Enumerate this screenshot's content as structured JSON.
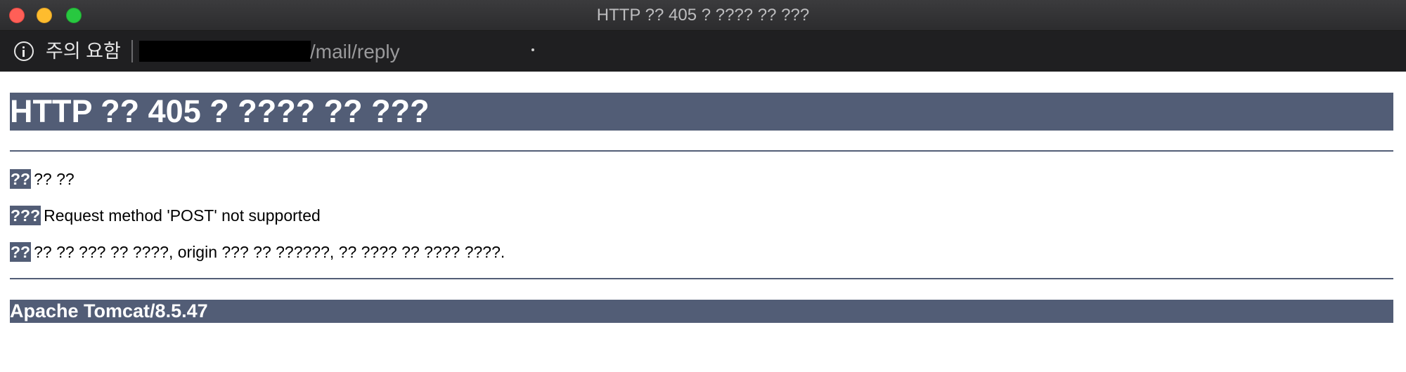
{
  "window": {
    "title": "HTTP ?? 405 ? ???? ?? ???"
  },
  "address_bar": {
    "security_label": "주의 요함",
    "url_visible": "/mail/reply",
    "icon": "info-icon"
  },
  "page": {
    "heading": "HTTP ?? 405 ? ???? ?? ???",
    "rows": [
      {
        "label": "??",
        "text": "?? ??"
      },
      {
        "label": "???",
        "text": "Request method 'POST' not supported"
      },
      {
        "label": "??",
        "text": "?? ?? ??? ?? ????, origin ??? ?? ??????, ?? ???? ?? ???? ????."
      }
    ],
    "footer": "Apache Tomcat/8.5.47"
  },
  "colors": {
    "tomcat_accent": "#525d76",
    "titlebar": "#2c2c2e",
    "addressbar": "#1f1f21",
    "close": "#ff5f57",
    "minimize": "#febc2e",
    "maximize": "#28c840"
  }
}
